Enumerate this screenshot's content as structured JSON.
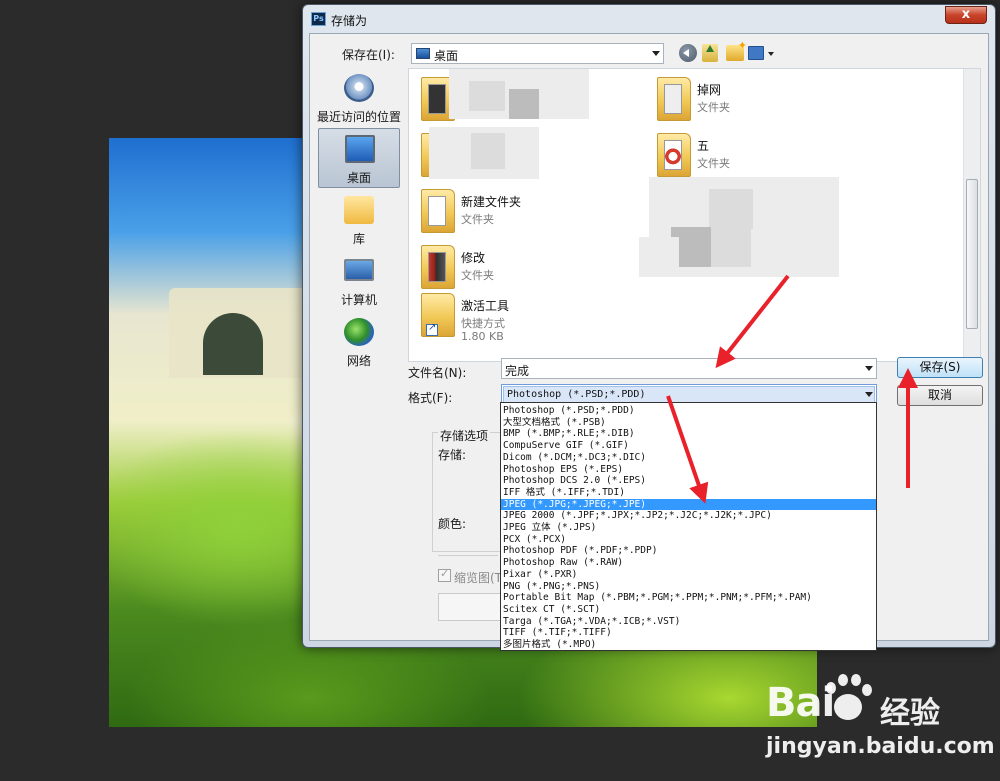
{
  "dialog": {
    "app_icon_text": "Ps",
    "title": "存储为",
    "close_label": "x"
  },
  "savein": {
    "label": "保存在(I):",
    "value": "桌面"
  },
  "places": [
    {
      "label": "最近访问的位置",
      "icon": "recent-places-icon"
    },
    {
      "label": "桌面",
      "icon": "desktop-icon",
      "selected": true
    },
    {
      "label": "库",
      "icon": "library-icon"
    },
    {
      "label": "计算机",
      "icon": "computer-icon"
    },
    {
      "label": "网络",
      "icon": "network-icon"
    }
  ],
  "files": [
    {
      "name": "掉网",
      "type": "文件夹"
    },
    {
      "name": "五",
      "type": "文件夹"
    },
    {
      "name": "新建文件夹",
      "type": "文件夹"
    },
    {
      "name": "修改",
      "type": "文件夹"
    },
    {
      "name": "激活工具",
      "type": "快捷方式",
      "size": "1.80 KB"
    }
  ],
  "filename": {
    "label": "文件名(N):",
    "value": "完成"
  },
  "format": {
    "label": "格式(F):",
    "value": "Photoshop (*.PSD;*.PDD)",
    "options": [
      "Photoshop (*.PSD;*.PDD)",
      "大型文档格式 (*.PSB)",
      "BMP (*.BMP;*.RLE;*.DIB)",
      "CompuServe GIF (*.GIF)",
      "Dicom (*.DCM;*.DC3;*.DIC)",
      "Photoshop EPS (*.EPS)",
      "Photoshop DCS 2.0 (*.EPS)",
      "IFF 格式 (*.IFF;*.TDI)",
      "JPEG (*.JPG;*.JPEG;*.JPE)",
      "JPEG 2000 (*.JPF;*.JPX;*.JP2;*.J2C;*.J2K;*.JPC)",
      "JPEG 立体 (*.JPS)",
      "PCX (*.PCX)",
      "Photoshop PDF (*.PDF;*.PDP)",
      "Photoshop Raw (*.RAW)",
      "Pixar (*.PXR)",
      "PNG (*.PNG;*.PNS)",
      "Portable Bit Map (*.PBM;*.PGM;*.PPM;*.PNM;*.PFM;*.PAM)",
      "Scitex CT (*.SCT)",
      "Targa (*.TGA;*.VDA;*.ICB;*.VST)",
      "TIFF (*.TIF;*.TIFF)",
      "多图片格式 (*.MPO)"
    ],
    "selected_option": "JPEG (*.JPG;*.JPEG;*.JPE)"
  },
  "buttons": {
    "save": "保存(S)",
    "cancel": "取消"
  },
  "save_options": {
    "title": "存储选项",
    "save_label": "存储:",
    "color_label": "颜色:",
    "thumbnail_label": "缩览图(T"
  },
  "watermark": {
    "logo": "Bai",
    "logo_suffix": "经验",
    "url": "jingyan.baidu.com"
  },
  "colors": {
    "selection": "#3399ff",
    "annotation_arrow": "#e8212a",
    "close_button": "#c8432a"
  }
}
